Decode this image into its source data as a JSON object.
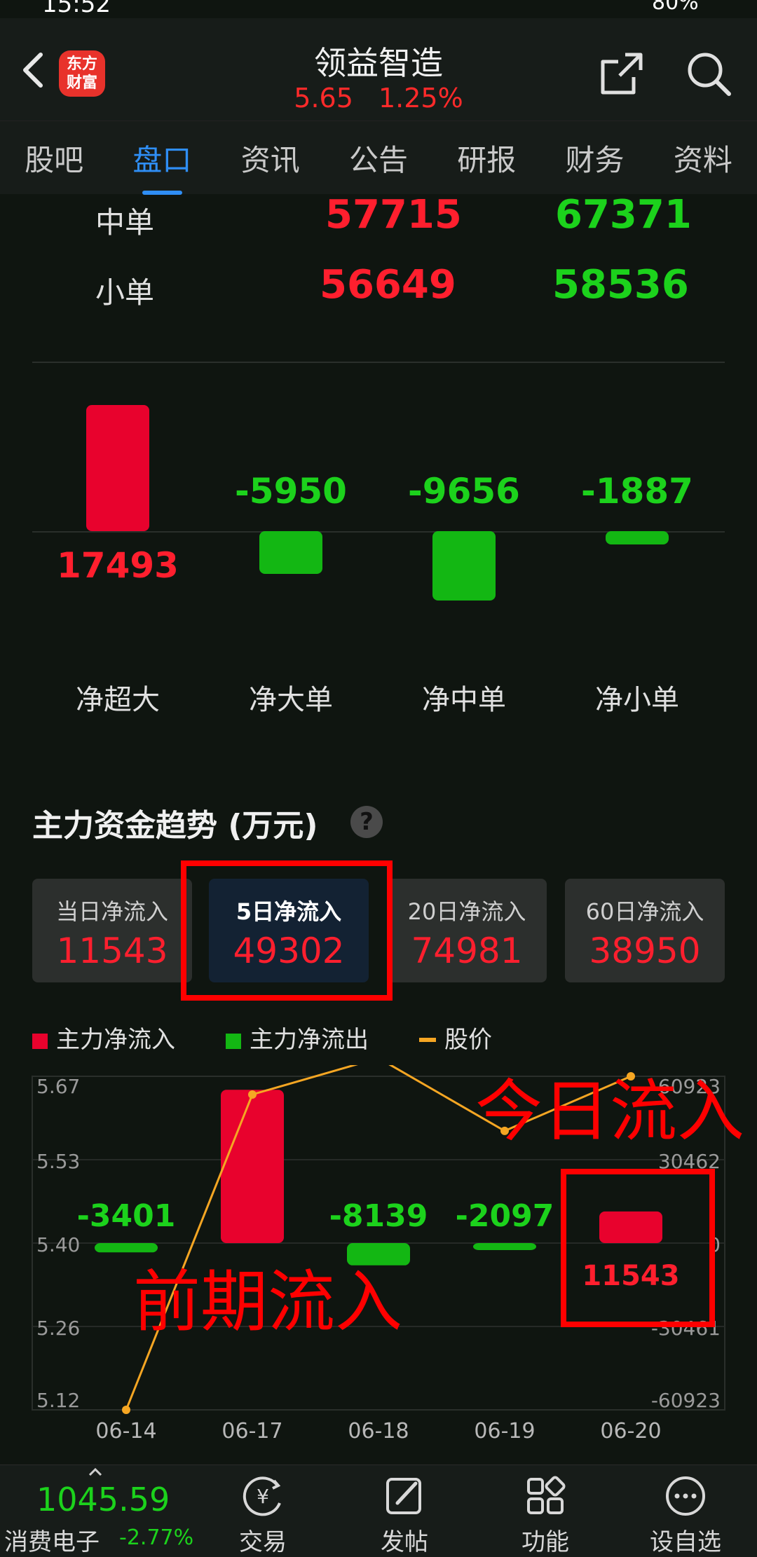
{
  "status_bar": {
    "time": "15:52",
    "battery": "80%"
  },
  "header": {
    "logo_line1": "东方",
    "logo_line2": "财富",
    "title": "领益智造",
    "price": "5.65",
    "change_pct": "1.25%"
  },
  "tabs": [
    "股吧",
    "盘口",
    "资讯",
    "公告",
    "研报",
    "财务",
    "资料"
  ],
  "active_tab": 1,
  "orders": [
    {
      "label": "中单",
      "inflow": "57715",
      "outflow": "67371"
    },
    {
      "label": "小单",
      "inflow": "56649",
      "outflow": "58536"
    }
  ],
  "net_flows": [
    {
      "label": "净超大",
      "value": 17493,
      "text": "17493"
    },
    {
      "label": "净大单",
      "value": -5950,
      "text": "-5950"
    },
    {
      "label": "净中单",
      "value": -9656,
      "text": "-9656"
    },
    {
      "label": "净小单",
      "value": -1887,
      "text": "-1887"
    }
  ],
  "section": {
    "title": "主力资金趋势 (万元)",
    "help": "?"
  },
  "period_cards": [
    {
      "label": "当日净流入",
      "value": "11543"
    },
    {
      "label": "5日净流入",
      "value": "49302"
    },
    {
      "label": "20日净流入",
      "value": "74981"
    },
    {
      "label": "60日净流入",
      "value": "38950"
    }
  ],
  "active_card": 1,
  "legend": {
    "inflow": "主力净流入",
    "outflow": "主力净流出",
    "price": "股价"
  },
  "colors": {
    "inflow": "#e8022d",
    "outflow": "#13b713",
    "price": "#f5a623",
    "highlight": "#ff0000",
    "accent": "#2f8ef5"
  },
  "chart_data": {
    "type": "bar",
    "categories": [
      "06-14",
      "06-17",
      "06-18",
      "06-19",
      "06-20"
    ],
    "series": [
      {
        "name": "主力净流入",
        "values": [
          -3401,
          56000,
          -8139,
          -2097,
          11543
        ]
      },
      {
        "name": "股价",
        "values": [
          5.12,
          5.64,
          5.7,
          5.58,
          5.67
        ]
      }
    ],
    "bar_labels": [
      "-3401",
      "",
      "-8139",
      "-2097",
      "11543"
    ],
    "y_left_ticks": [
      "5.67",
      "5.53",
      "5.40",
      "5.26",
      "5.12"
    ],
    "y_left_range": [
      5.12,
      5.67
    ],
    "y_right_ticks": [
      "60923",
      "30462",
      "0",
      "-30461",
      "-60923"
    ],
    "y_right_range": [
      -60923,
      60923
    ]
  },
  "annotations": {
    "today": "今日流入",
    "previous": "前期流入"
  },
  "bottom_bar": {
    "index_value": "1045.59",
    "index_name": "消费电子",
    "index_change": "-2.77%",
    "items": [
      "交易",
      "发帖",
      "功能",
      "设自选"
    ]
  }
}
